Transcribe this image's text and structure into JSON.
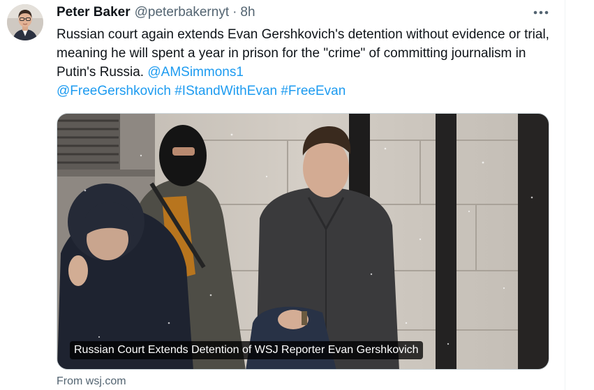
{
  "author": {
    "display_name": "Peter Baker",
    "handle": "@peterbakernyt",
    "separator": "·",
    "time": "8h",
    "avatar_icon": "person-avatar"
  },
  "more_icon": "more-options-icon",
  "tweet": {
    "text_part1": "Russian court again extends Evan Gershkovich's detention without evidence or trial, meaning he will spent a year in prison for the \"crime\" of committing journalism in Putin's Russia. ",
    "mention": "@AMSimmons1",
    "space": " ",
    "hashtag1": "@FreeGershkovich",
    "hashtag2": "#IStandWithEvan",
    "hashtag3": "#FreeEvan"
  },
  "card": {
    "caption": "Russian Court Extends Detention of WSJ Reporter Evan Gershkovich",
    "source": "From wsj.com"
  },
  "colors": {
    "link": "#1d9bf0",
    "secondary_text": "#536471",
    "primary_text": "#0f1419"
  }
}
